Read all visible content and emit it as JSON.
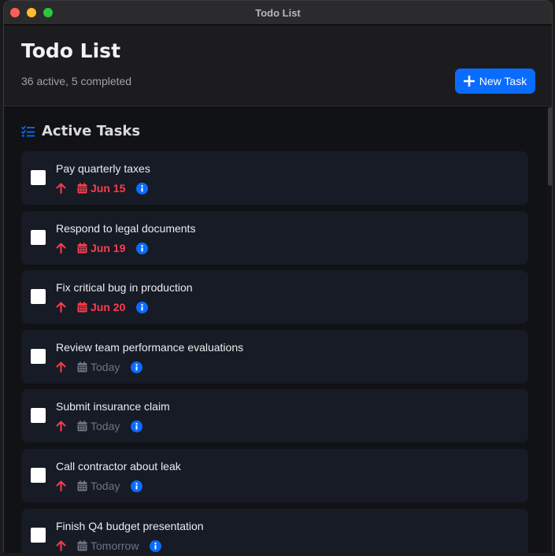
{
  "window": {
    "title": "Todo List"
  },
  "header": {
    "title": "Todo List",
    "subtitle": "36 active, 5 completed",
    "new_task_label": "New Task"
  },
  "section": {
    "title": "Active Tasks"
  },
  "colors": {
    "accent": "#0a6cff",
    "overdue": "#ff3b4a",
    "priority_high": "#ff3b4a",
    "muted": "#6f7480"
  },
  "tasks": [
    {
      "title": "Pay quarterly taxes",
      "date": "Jun 15",
      "overdue": true,
      "priority": "high"
    },
    {
      "title": "Respond to legal documents",
      "date": "Jun 19",
      "overdue": true,
      "priority": "high"
    },
    {
      "title": "Fix critical bug in production",
      "date": "Jun 20",
      "overdue": true,
      "priority": "high"
    },
    {
      "title": "Review team performance evaluations",
      "date": "Today",
      "overdue": false,
      "priority": "high"
    },
    {
      "title": "Submit insurance claim",
      "date": "Today",
      "overdue": false,
      "priority": "high"
    },
    {
      "title": "Call contractor about leak",
      "date": "Today",
      "overdue": false,
      "priority": "high"
    },
    {
      "title": "Finish Q4 budget presentation",
      "date": "Tomorrow",
      "overdue": false,
      "priority": "high"
    }
  ],
  "icons": {
    "priority": "arrow-up-icon",
    "date": "calendar-icon",
    "info": "info-icon",
    "section": "checklist-icon",
    "add": "plus-icon"
  }
}
